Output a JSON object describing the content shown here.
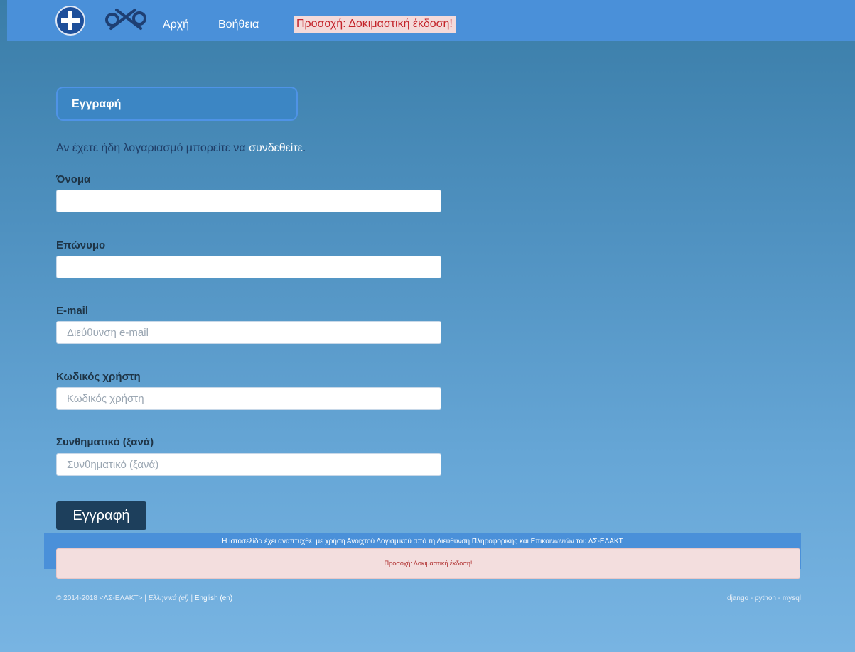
{
  "nav": {
    "home": "Αρχή",
    "help": "Βοήθεια",
    "warning": "Προσοχή: Δοκιμαστική έκδοση!"
  },
  "form": {
    "title": "Εγγραφή",
    "intro_prefix": "Αν έχετε ήδη λογαριασμό μπορείτε να ",
    "intro_link": "συνδεθείτε",
    "intro_suffix": ".",
    "fields": [
      {
        "label": "Όνομα",
        "value": "",
        "placeholder": ""
      },
      {
        "label": "Επώνυμο",
        "value": "",
        "placeholder": ""
      },
      {
        "label": "E-mail",
        "value": "",
        "placeholder": "Διεύθυνση e-mail"
      },
      {
        "label": "Κωδικός χρήστη",
        "value": "",
        "placeholder": "Κωδικός χρήστη"
      },
      {
        "label": "Συνθηματικό (ξανά)",
        "value": "",
        "placeholder": "Συνθηματικό (ξανά)"
      }
    ],
    "submit_label": "Εγγραφή"
  },
  "footer": {
    "note": "Η ιστοσελίδα έχει αναπτυχθεί με χρήση Ανοιχτού Λογισμικού από τη Διεύθυνση Πληροφορικής και Επικοινωνιών του ΛΣ-ΕΛΑΚΤ",
    "alert": "Προσοχή: Δοκιμαστική έκδοση!",
    "copyright": "© 2014-2018 <ΛΣ-ΕΛΑΚΤ> | ",
    "lang_el": "Ελληνικά (el)",
    "separator": " | ",
    "lang_en": "English (en)",
    "tech": "django - python - mysql"
  },
  "colors": {
    "navbar": "#4a90d9",
    "warning_bg": "#f4dada",
    "warning_text": "#c3242b",
    "button": "#1d3f5c"
  }
}
